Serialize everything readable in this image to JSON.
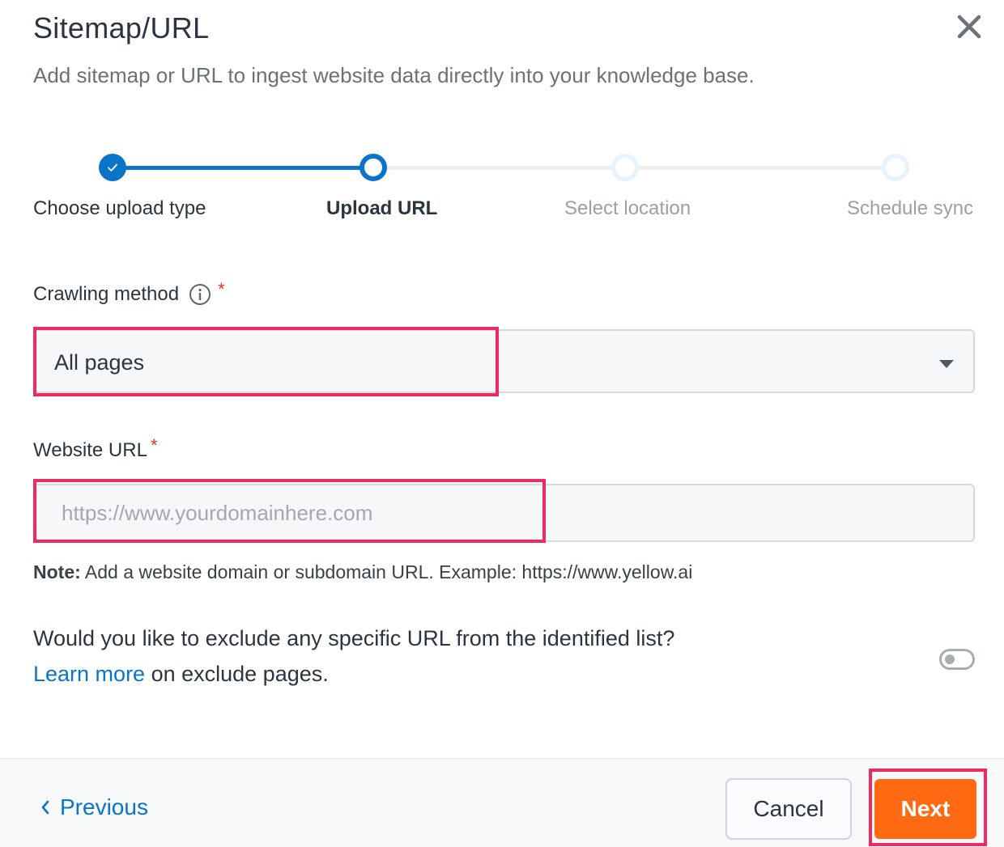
{
  "dialog": {
    "title": "Sitemap/URL",
    "subtitle": "Add sitemap or URL to ingest website data directly into your knowledge base."
  },
  "stepper": {
    "steps": [
      {
        "label": "Choose upload type",
        "state": "completed"
      },
      {
        "label": "Upload URL",
        "state": "active"
      },
      {
        "label": "Select location",
        "state": "pending"
      },
      {
        "label": "Schedule sync",
        "state": "pending"
      }
    ]
  },
  "crawling_method": {
    "label": "Crawling method",
    "required_mark": "*",
    "value": "All pages"
  },
  "website_url": {
    "label": "Website URL",
    "required_mark": "*",
    "value": "",
    "placeholder": "https://www.yourdomainhere.com"
  },
  "note": {
    "prefix": "Note:",
    "text": " Add a website domain or subdomain URL. Example: https://www.yellow.ai"
  },
  "exclude": {
    "question": "Would you like to exclude any specific URL from the identified list?",
    "link_text": "Learn more",
    "suffix": " on exclude pages.",
    "toggle_on": false
  },
  "footer": {
    "previous_label": "Previous",
    "cancel_label": "Cancel",
    "next_label": "Next"
  },
  "colors": {
    "accent": "#0b74c8",
    "primary_button": "#ff6a13",
    "highlight": "#ee2a62",
    "required": "#e0312f"
  }
}
